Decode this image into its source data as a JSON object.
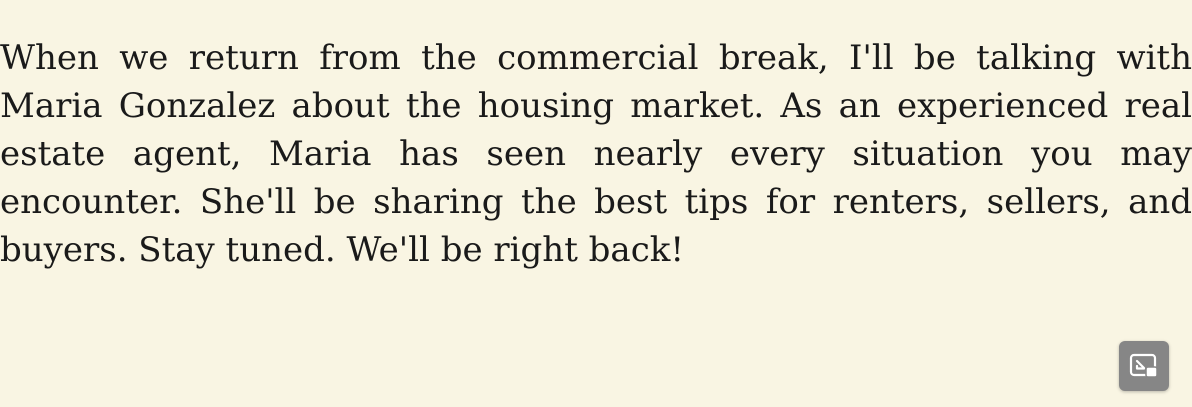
{
  "reader": {
    "passage": "When we return from the commercial break, I'll be talking with Maria Gonzalez about the housing market. As an experienced real estate agent, Maria has seen nearly every situation you may encounter. She'll be sharing the best tips for renters, sellers, and buyers. Stay tuned. We'll be right back!"
  },
  "controls": {
    "pip_icon": "picture-in-picture-exit-icon"
  },
  "colors": {
    "background": "#f9f5e3",
    "text": "#1a1a1a",
    "button_bg": "#868686",
    "button_icon": "#ffffff"
  }
}
